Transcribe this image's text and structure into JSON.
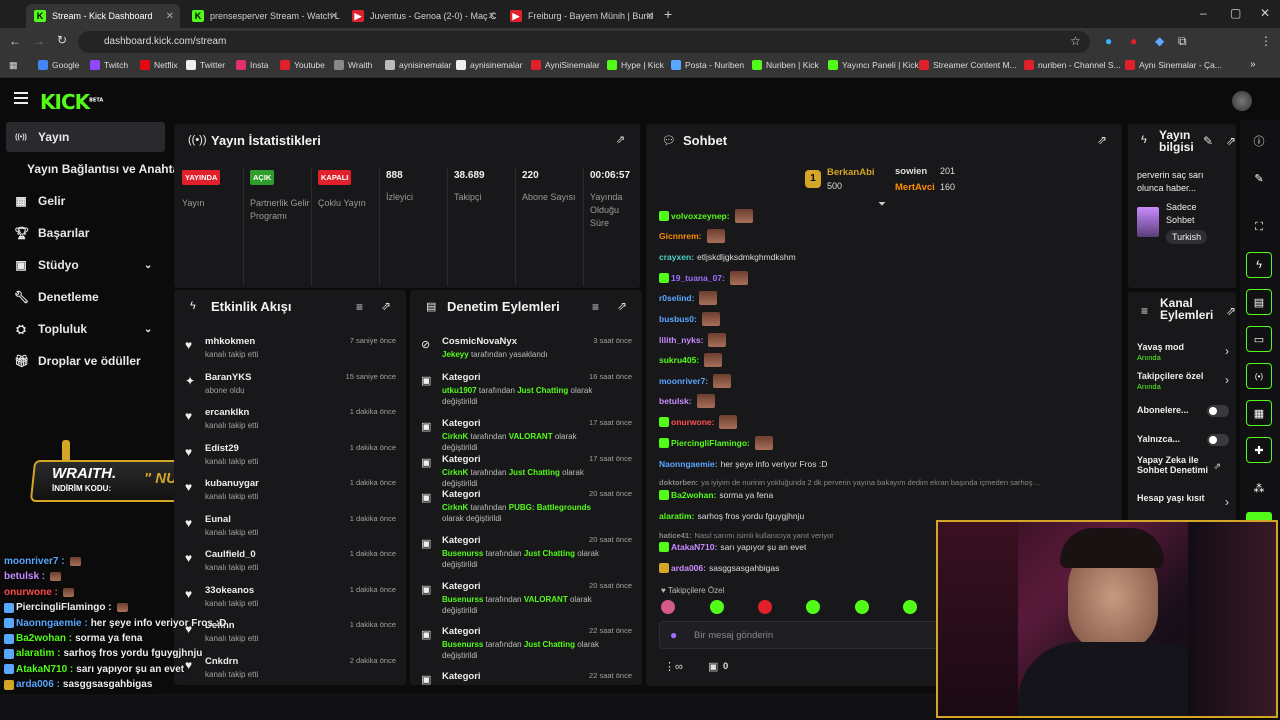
{
  "browser": {
    "tabs": [
      {
        "title": "Stream - Kick Dashboard",
        "active": true
      },
      {
        "title": "prensesperver Stream - Watch L",
        "active": false
      },
      {
        "title": "Juventus - Genoa (2-0) - Maç C",
        "active": false
      },
      {
        "title": "Freiburg - Bayern Münih | Bund",
        "active": false
      }
    ],
    "url": "dashboard.kick.com/stream",
    "bookmarks": [
      "Google",
      "Twitch",
      "Netflix",
      "Twitter",
      "Insta",
      "Youtube",
      "Wraith",
      "aynisinemalar",
      "aynisinemalar",
      "AyniSinemalar",
      "Hype | Kick",
      "Posta - Nuriben",
      "Nuriben | Kick",
      "Yayıncı Paneli | Kick",
      "Streamer Content M...",
      "nuriben - Channel S...",
      "Aynı Sinemalar - Ça..."
    ]
  },
  "app": {
    "logo": "KICK",
    "logo_sup": "BETA"
  },
  "sidebar": {
    "items": [
      {
        "label": "Yayın",
        "icon": "broadcast-icon",
        "active": true
      },
      {
        "label": "Yayın Bağlantısı ve Anahtarı",
        "icon": "",
        "active": false
      },
      {
        "label": "Gelir",
        "icon": "chart-icon",
        "active": false
      },
      {
        "label": "Başarılar",
        "icon": "trophy-icon",
        "active": false
      },
      {
        "label": "Stüdyo",
        "icon": "studio-icon",
        "active": false
      },
      {
        "label": "Denetleme",
        "icon": "wrench-icon",
        "active": false
      },
      {
        "label": "Topluluk",
        "icon": "community-icon",
        "active": false
      },
      {
        "label": "Droplar ve ödüller",
        "icon": "gift-icon",
        "active": false
      }
    ]
  },
  "promo": {
    "brand": "WRAITH.",
    "code_label": "İNDİRİM KODU:",
    "code": "\" NURİ \""
  },
  "stats": {
    "title": "Yayın İstatistikleri",
    "cols": [
      {
        "badge": "YAYINDA",
        "label": "Yayın",
        "color": "#e0202a"
      },
      {
        "badge": "AÇIK",
        "label": "Partnerlik Gelir Programı",
        "color": "#2f9e2a"
      },
      {
        "badge": "KAPALI",
        "label": "Çoklu Yayın",
        "color": "#e0202a"
      },
      {
        "value": "888",
        "label": "İzleyici"
      },
      {
        "value": "38.689",
        "label": "Takipçi"
      },
      {
        "value": "220",
        "label": "Abone Sayısı"
      },
      {
        "value": "00:06:57",
        "label": "Yayında Olduğu Süre"
      }
    ]
  },
  "activity": {
    "title": "Etkinlik Akışı",
    "items": [
      {
        "name": "mhkokmen",
        "sub": "kanalı takip etti",
        "time": "7 saniye önce",
        "icon": "heart"
      },
      {
        "name": "BaranYKS",
        "sub": "abone oldu",
        "time": "15 saniye önce",
        "icon": "star"
      },
      {
        "name": "ercanklkn",
        "sub": "kanalı takip etti",
        "time": "1 dakika önce",
        "icon": "heart"
      },
      {
        "name": "Edist29",
        "sub": "kanalı takip etti",
        "time": "1 dakika önce",
        "icon": "heart"
      },
      {
        "name": "kubanuygar",
        "sub": "kanalı takip etti",
        "time": "1 dakika önce",
        "icon": "heart"
      },
      {
        "name": "Eunal",
        "sub": "kanalı takip etti",
        "time": "1 dakika önce",
        "icon": "heart"
      },
      {
        "name": "Caulfield_0",
        "sub": "kanalı takip etti",
        "time": "1 dakika önce",
        "icon": "heart"
      },
      {
        "name": "33okeanos",
        "sub": "kanalı takip etti",
        "time": "1 dakika önce",
        "icon": "heart"
      },
      {
        "name": "Definn",
        "sub": "kanalı takip etti",
        "time": "1 dakika önce",
        "icon": "heart"
      },
      {
        "name": "Cnkdrn",
        "sub": "kanalı takip etti",
        "time": "2 dakika önce",
        "icon": "heart"
      }
    ]
  },
  "moderation": {
    "title": "Denetim Eylemleri",
    "items": [
      {
        "name": "CosmicNovaNyx",
        "actor": "Jekeyy",
        "text": "tarafından yasaklandı",
        "cat": "",
        "tail": "",
        "time": "3 saat önce"
      },
      {
        "name": "Kategori",
        "actor": "utku1907",
        "text": "tarafından",
        "cat": "Just Chatting",
        "tail": "olarak değiştirildi",
        "time": "16 saat önce"
      },
      {
        "name": "Kategori",
        "actor": "CirknK",
        "text": "tarafından",
        "cat": "VALORANT",
        "tail": "olarak değiştirildi",
        "time": "17 saat önce"
      },
      {
        "name": "Kategori",
        "actor": "CirknK",
        "text": "tarafından",
        "cat": "Just Chatting",
        "tail": "olarak değiştirildi",
        "time": "17 saat önce"
      },
      {
        "name": "Kategori",
        "actor": "CirknK",
        "text": "tarafından",
        "cat": "PUBG: Battlegrounds",
        "tail": "olarak değiştirildi",
        "time": "20 saat önce"
      },
      {
        "name": "Kategori",
        "actor": "Busenurss",
        "text": "tarafından",
        "cat": "Just Chatting",
        "tail": "olarak değiştirildi",
        "time": "20 saat önce"
      },
      {
        "name": "Kategori",
        "actor": "Busenurss",
        "text": "tarafından",
        "cat": "VALORANT",
        "tail": "olarak değiştirildi",
        "time": "20 saat önce"
      },
      {
        "name": "Kategori",
        "actor": "Busenurss",
        "text": "tarafından",
        "cat": "Just Chatting",
        "tail": "olarak değiştirildi",
        "time": "22 saat önce"
      },
      {
        "name": "Kategori",
        "actor": "",
        "text": "",
        "cat": "",
        "tail": "",
        "time": "22 saat önce"
      }
    ]
  },
  "chat": {
    "title": "Sohbet",
    "leaders": [
      {
        "rank": "1",
        "name": "BerkanAbi",
        "value": "500"
      },
      {
        "rank": "",
        "name": "sowien",
        "value": "201"
      },
      {
        "rank": "",
        "name": "MertAvci",
        "value": "160"
      }
    ],
    "messages": [
      {
        "user": "volvoxzeynep:",
        "color": "#53fc18",
        "text": ""
      },
      {
        "user": "Gicnnrem:",
        "color": "#ff8c00",
        "text": ""
      },
      {
        "user": "crayxen:",
        "color": "#4fd1c5",
        "text": "etljskdljgksdmkghmdkshm"
      },
      {
        "user": "19_tuana_07:",
        "color": "#a06cff",
        "text": ""
      },
      {
        "user": "r0selind:",
        "color": "#5aa7ff",
        "text": ""
      },
      {
        "user": "busbus0:",
        "color": "#5aa7ff",
        "text": ""
      },
      {
        "user": "lilith_nyks:",
        "color": "#c98cff",
        "text": ""
      },
      {
        "user": "sukru405:",
        "color": "#53fc18",
        "text": ""
      },
      {
        "user": "moonriver7:",
        "color": "#5aa7ff",
        "text": ""
      },
      {
        "user": "betulsk:",
        "color": "#c98cff",
        "text": ""
      },
      {
        "user": "onurwone:",
        "color": "#ff4d4d",
        "text": ""
      },
      {
        "user": "PiercingliFlamingo:",
        "color": "#53fc18",
        "text": ""
      },
      {
        "user": "Naonngaemie:",
        "color": "#5aa7ff",
        "text": "her şeye info veriyor Fros :D"
      },
      {
        "user": "doktorben:",
        "color": "#888",
        "text": "ya iyiyim de nurinin yokluğunda 2 dk perverin yayına bakayım dedim ekran başında içmeden sarhoş ..."
      },
      {
        "user": "Ba2wohan:",
        "color": "#53fc18",
        "text": "sorma ya fena"
      },
      {
        "user": "alaratim:",
        "color": "#53fc18",
        "text": "sarhoş fros yordu fguygjhnju"
      },
      {
        "user": "hatice41:",
        "color": "#888",
        "text": "Nasıl sarımı isimli kullanıcıya yanıt veriyor"
      },
      {
        "user": "AtakaN710:",
        "color": "#c98cff",
        "text": "sarı yapıyor şu an evet"
      },
      {
        "user": "arda006:",
        "color": "#c98cff",
        "text": "sasggsasgahbigas"
      }
    ],
    "followers_only": "Takipçilere Özel",
    "input_placeholder": "Bir mesaj gönderin",
    "count": "0"
  },
  "overlay_chat": [
    {
      "user": "moonriver7 :",
      "color": "#5aa7ff",
      "text": ""
    },
    {
      "user": "betulsk :",
      "color": "#c98cff",
      "text": ""
    },
    {
      "user": "onurwone :",
      "color": "#ff4d4d",
      "text": ""
    },
    {
      "user": "PiercingliFlamingo :",
      "color": "#eee",
      "text": ""
    },
    {
      "user": "Naonngaemie :",
      "color": "#5aa7ff",
      "text": "her şeye info veriyor Fros :D"
    },
    {
      "user": "Ba2wohan :",
      "color": "#53fc18",
      "text": "sorma ya fena"
    },
    {
      "user": "alaratim :",
      "color": "#53fc18",
      "text": "sarhoş fros yordu fguygjhnju"
    },
    {
      "user": "AtakaN710 :",
      "color": "#53fc18",
      "text": "sarı yapıyor şu an evet"
    },
    {
      "user": "arda006 :",
      "color": "#5aa7ff",
      "text": "sasggsasgahbigas"
    }
  ],
  "stream_info": {
    "title": "Yayın bilgisi",
    "text": "perverin saç sarı olunca haber...",
    "tag1": "Sadece Sohbet",
    "tag2": "Turkish"
  },
  "channel_actions": {
    "title": "Kanal Eylemleri",
    "items": [
      {
        "label": "Yavaş mod",
        "sub": "Anında",
        "type": "chevron"
      },
      {
        "label": "Takipçilere özel",
        "sub": "Anında",
        "type": "chevron"
      },
      {
        "label": "Abonelere...",
        "sub": "",
        "type": "toggle"
      },
      {
        "label": "Yalnızca...",
        "sub": "",
        "type": "toggle"
      },
      {
        "label": "Yapay Zeka ile Sohbet Denetimi",
        "sub": "",
        "type": "external"
      },
      {
        "label": "Hesap yaşı kısıt",
        "sub": "",
        "type": "chevron"
      }
    ]
  },
  "colors": {
    "accent": "#53fc18",
    "live": "#e0202a",
    "panel": "#18181b"
  }
}
